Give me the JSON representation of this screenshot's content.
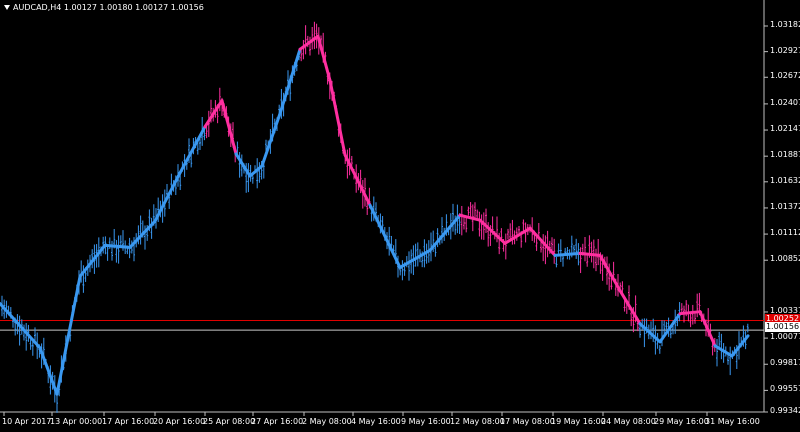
{
  "header": {
    "symbol": "AUDCAD,H4",
    "prices": "1.00127 1.00180 1.00127 1.00156"
  },
  "colors": {
    "background": "#000000",
    "axis": "#c0c0c0",
    "bull": "#3a98f0",
    "bear": "#ff2fa0",
    "red_line": "#e00000",
    "white_line": "#c8c8c8"
  },
  "chart_data": {
    "type": "line",
    "title": "",
    "ylim": [
      0.99342,
      1.0344
    ],
    "y_ticks": [
      "1.03182",
      "1.02927",
      "1.02672",
      "1.02407",
      "1.02147",
      "1.01887",
      "1.01632",
      "1.01372",
      "1.01112",
      "1.00852",
      "1.00337",
      "1.00077",
      "0.99817",
      "0.99557",
      "0.99342"
    ],
    "x_ticks": [
      "10 Apr 2017",
      "13 Apr 00:00",
      "17 Apr 16:00",
      "20 Apr 16:00",
      "25 Apr 08:00",
      "27 Apr 16:00",
      "2 May 08:00",
      "4 May 16:00",
      "9 May 16:00",
      "12 May 08:00",
      "17 May 08:00",
      "19 May 16:00",
      "24 May 08:00",
      "29 May 16:00",
      "31 May 16:00"
    ],
    "current_bid": "1.00156",
    "red_level": "1.00252",
    "white_level": "1.00156",
    "ma_series": {
      "name": "",
      "x": [
        0,
        40,
        57,
        80,
        105,
        130,
        155,
        180,
        205,
        222,
        236,
        250,
        262,
        280,
        300,
        318,
        330,
        345,
        370,
        400,
        430,
        460,
        480,
        505,
        530,
        555,
        580,
        600,
        620,
        640,
        660,
        680,
        700,
        715,
        732,
        748
      ],
      "y": [
        1.0042,
        0.9998,
        0.9952,
        1.0069,
        1.01,
        1.0098,
        1.0124,
        1.0172,
        1.0218,
        1.0244,
        1.0191,
        1.0169,
        1.0179,
        1.0231,
        1.0295,
        1.0308,
        1.0264,
        1.019,
        1.014,
        1.0078,
        1.0095,
        1.013,
        1.0125,
        1.0102,
        1.0117,
        1.009,
        1.0092,
        1.009,
        1.0055,
        1.0022,
        1.0004,
        1.0032,
        1.0034,
        1.0,
        0.999,
        1.001
      ],
      "colors": [
        "bear",
        "bull",
        "bull",
        "bull",
        "bull",
        "bull",
        "bull",
        "bull",
        "bull",
        "bear",
        "bear",
        "bull",
        "bull",
        "bull",
        "bull",
        "bear",
        "bear",
        "bear",
        "bear",
        "bull",
        "bull",
        "bull",
        "bear",
        "bear",
        "bear",
        "bear",
        "bull",
        "bear",
        "bear",
        "bear",
        "bull",
        "bull",
        "bear",
        "bear",
        "bull",
        "bull"
      ]
    }
  }
}
